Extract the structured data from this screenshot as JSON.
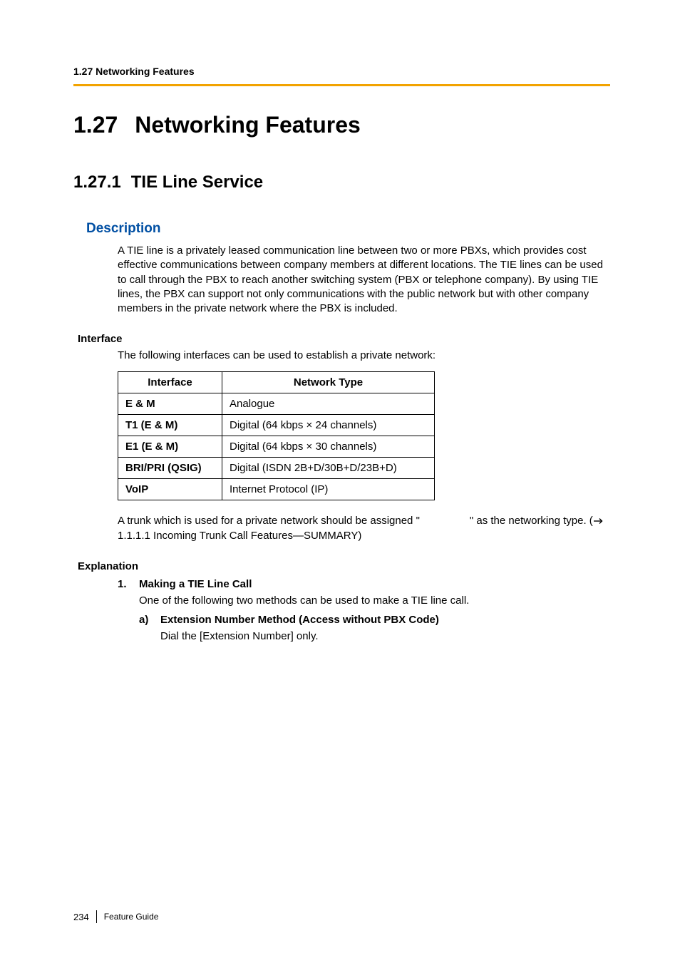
{
  "running_header": "1.27 Networking Features",
  "h1": {
    "num": "1.27",
    "title": "Networking Features"
  },
  "h2": {
    "num": "1.27.1",
    "title": "TIE Line Service"
  },
  "description_heading": "Description",
  "description_body": "A TIE line is a privately leased communication line between two or more PBXs, which provides cost effective communications between company members at different locations. The TIE lines can be used to call through the PBX to reach another switching system (PBX or telephone company). By using TIE lines, the PBX can support not only communications with the public network but with other company members in the private network where the PBX is included.",
  "interface_heading": "Interface",
  "interface_intro": "The following interfaces can be used to establish a private network:",
  "table": {
    "headers": [
      "Interface",
      "Network Type"
    ],
    "rows": [
      {
        "iface": "E & M",
        "type": "Analogue"
      },
      {
        "iface": "T1 (E & M)",
        "type": "Digital (64 kbps × 24 channels)"
      },
      {
        "iface": "E1 (E & M)",
        "type": "Digital (64 kbps × 30 channels)"
      },
      {
        "iface": "BRI/PRI (QSIG)",
        "type": "Digital (ISDN 2B+D/30B+D/23B+D)"
      },
      {
        "iface": "VoIP",
        "type": "Internet Protocol (IP)"
      }
    ]
  },
  "after_table": {
    "prefix": "A trunk which is used for a private network should be assigned \"",
    "suffix": "\" as the networking type. (",
    "xref": " 1.1.1.1 Incoming Trunk Call Features—SUMMARY)"
  },
  "explanation_heading": "Explanation",
  "list": {
    "item1": {
      "marker": "1.",
      "title": "Making a TIE Line Call",
      "body": "One of the following two methods can be used to make a TIE line call.",
      "sub_a": {
        "marker": "a)",
        "title": "Extension Number Method (Access without PBX Code)",
        "body": "Dial the [Extension Number] only."
      }
    }
  },
  "footer": {
    "page": "234",
    "doc": "Feature Guide"
  }
}
